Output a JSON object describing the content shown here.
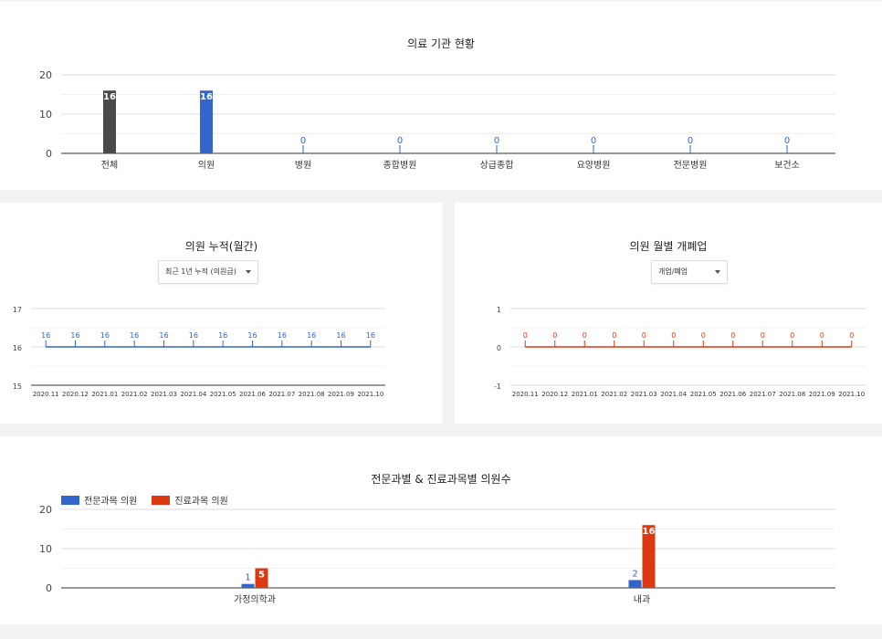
{
  "chart_data": [
    {
      "type": "bar",
      "title": "의료 기관 현황",
      "categories": [
        "전체",
        "의원",
        "병원",
        "종합병원",
        "상급종합",
        "요양병원",
        "전문병원",
        "보건소"
      ],
      "values": [
        16,
        16,
        0,
        0,
        0,
        0,
        0,
        0
      ],
      "bar_colors": [
        "#4a4a4a",
        "#3366cc",
        "#3366cc",
        "#3366cc",
        "#3366cc",
        "#3366cc",
        "#3366cc",
        "#3366cc"
      ],
      "ylim": [
        0,
        20
      ],
      "yticks": [
        0,
        10,
        20
      ],
      "grid": true
    },
    {
      "type": "line",
      "title": "의원 누적(월간)",
      "x": [
        "2020.11",
        "2020.12",
        "2021.01",
        "2021.02",
        "2021.03",
        "2021.04",
        "2021.05",
        "2021.06",
        "2021.07",
        "2021.08",
        "2021.09",
        "2021.10"
      ],
      "values": [
        16,
        16,
        16,
        16,
        16,
        16,
        16,
        16,
        16,
        16,
        16,
        16
      ],
      "color": "#3366cc",
      "ylim": [
        15,
        17
      ],
      "yticks": [
        15,
        16,
        17
      ],
      "grid": true
    },
    {
      "type": "line",
      "title": "의원 월별 개폐업",
      "x": [
        "2020.11",
        "2020.12",
        "2021.01",
        "2021.02",
        "2021.03",
        "2021.04",
        "2021.05",
        "2021.06",
        "2021.07",
        "2021.08",
        "2021.09",
        "2021.10"
      ],
      "values": [
        0,
        0,
        0,
        0,
        0,
        0,
        0,
        0,
        0,
        0,
        0,
        0
      ],
      "color": "#dc3912",
      "ylim": [
        -1,
        1
      ],
      "yticks": [
        -1,
        0,
        1
      ],
      "grid": true
    },
    {
      "type": "bar",
      "title": "전문과별 & 진료과목별 의원수",
      "categories": [
        "가정의학과",
        "내과"
      ],
      "series": [
        {
          "name": "전문과목 의원",
          "values": [
            1,
            2
          ],
          "color": "#3366cc"
        },
        {
          "name": "진료과목 의원",
          "values": [
            5,
            16
          ],
          "color": "#dc3912"
        }
      ],
      "ylim": [
        0,
        20
      ],
      "yticks": [
        0,
        10,
        20
      ],
      "legend": "top-left",
      "grid": true
    }
  ],
  "controls": {
    "cumulative_select": "최근 1년 누적 (의원급)",
    "openclose_select": "개업/폐업"
  }
}
